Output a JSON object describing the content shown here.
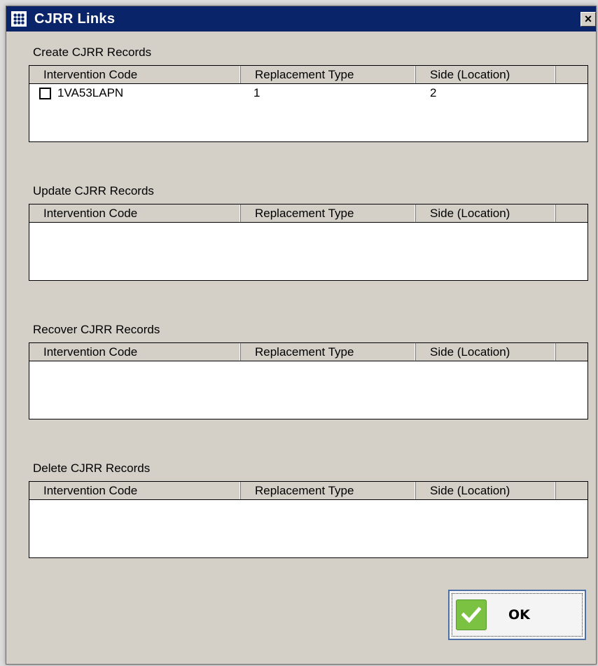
{
  "window": {
    "title": "CJRR Links",
    "close_glyph": "×"
  },
  "sections": [
    {
      "label": "Create CJRR Records",
      "columns": [
        "Intervention Code",
        "Replacement Type",
        "Side (Location)",
        ""
      ],
      "rows": [
        {
          "checked": false,
          "intervention_code": "1VA53LAPN",
          "replacement_type": "1",
          "side": "2"
        }
      ]
    },
    {
      "label": "Update CJRR Records",
      "columns": [
        "Intervention Code",
        "Replacement Type",
        "Side (Location)",
        ""
      ],
      "rows": []
    },
    {
      "label": "Recover CJRR Records",
      "columns": [
        "Intervention Code",
        "Replacement Type",
        "Side (Location)",
        ""
      ],
      "rows": []
    },
    {
      "label": "Delete CJRR Records",
      "columns": [
        "Intervention Code",
        "Replacement Type",
        "Side (Location)",
        ""
      ],
      "rows": []
    }
  ],
  "ok_button": {
    "label": "OK",
    "icon": "checkmark-icon"
  },
  "colors": {
    "titlebar": "#0a246a",
    "dialog_bg": "#d4d0c8",
    "ok_icon": "#7cc242"
  }
}
